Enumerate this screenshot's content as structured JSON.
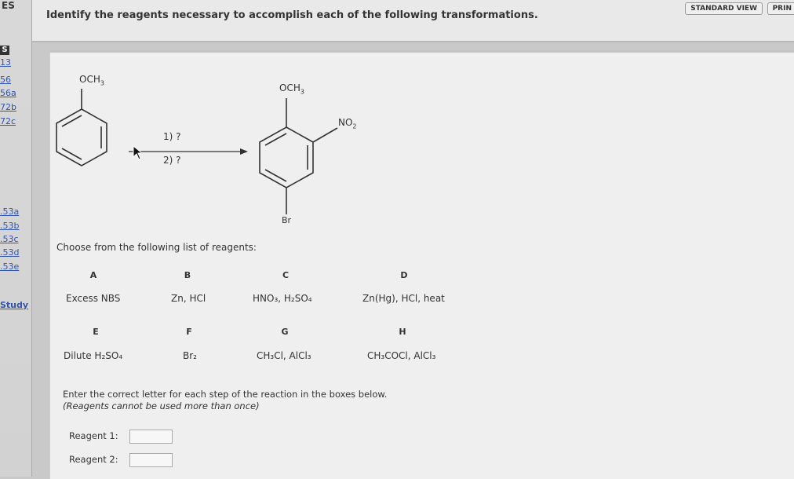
{
  "nav": {
    "top_label": "ES",
    "badge": "S",
    "links": [
      "13",
      "56",
      "56a",
      "72b",
      "72c",
      ".53a",
      ".53b",
      ".53c",
      ".53d",
      ".53e"
    ],
    "study": "Study"
  },
  "header": {
    "title": "Identify the reagents necessary to accomplish each of the following transformations.",
    "standard_view": "STANDARD VIEW",
    "print": "PRIN"
  },
  "scheme": {
    "start_substituent": "OCH",
    "start_sub": "3",
    "step1": "1) ?",
    "step2": "2) ?",
    "product_och": "OCH",
    "product_sub": "3",
    "product_no2": "NO",
    "product_no2_sub": "2",
    "product_br": "Br"
  },
  "choices": {
    "intro": "Choose from the following list of reagents:",
    "items": [
      {
        "letter": "A",
        "reagent": "Excess NBS"
      },
      {
        "letter": "B",
        "reagent": "Zn, HCl"
      },
      {
        "letter": "C",
        "reagent": "HNO₃, H₂SO₄"
      },
      {
        "letter": "D",
        "reagent": "Zn(Hg), HCl, heat"
      },
      {
        "letter": "E",
        "reagent": "Dilute H₂SO₄"
      },
      {
        "letter": "F",
        "reagent": "Br₂"
      },
      {
        "letter": "G",
        "reagent": "CH₃Cl, AlCl₃"
      },
      {
        "letter": "H",
        "reagent": "CH₃COCl, AlCl₃"
      }
    ]
  },
  "instructions": {
    "line1": "Enter the correct letter for each step of the reaction in the boxes below.",
    "line2": "(Reagents cannot be used more than once)"
  },
  "answers": {
    "reagent1_label": "Reagent 1:",
    "reagent1_value": "",
    "reagent2_label": "Reagent 2:",
    "reagent2_value": ""
  }
}
